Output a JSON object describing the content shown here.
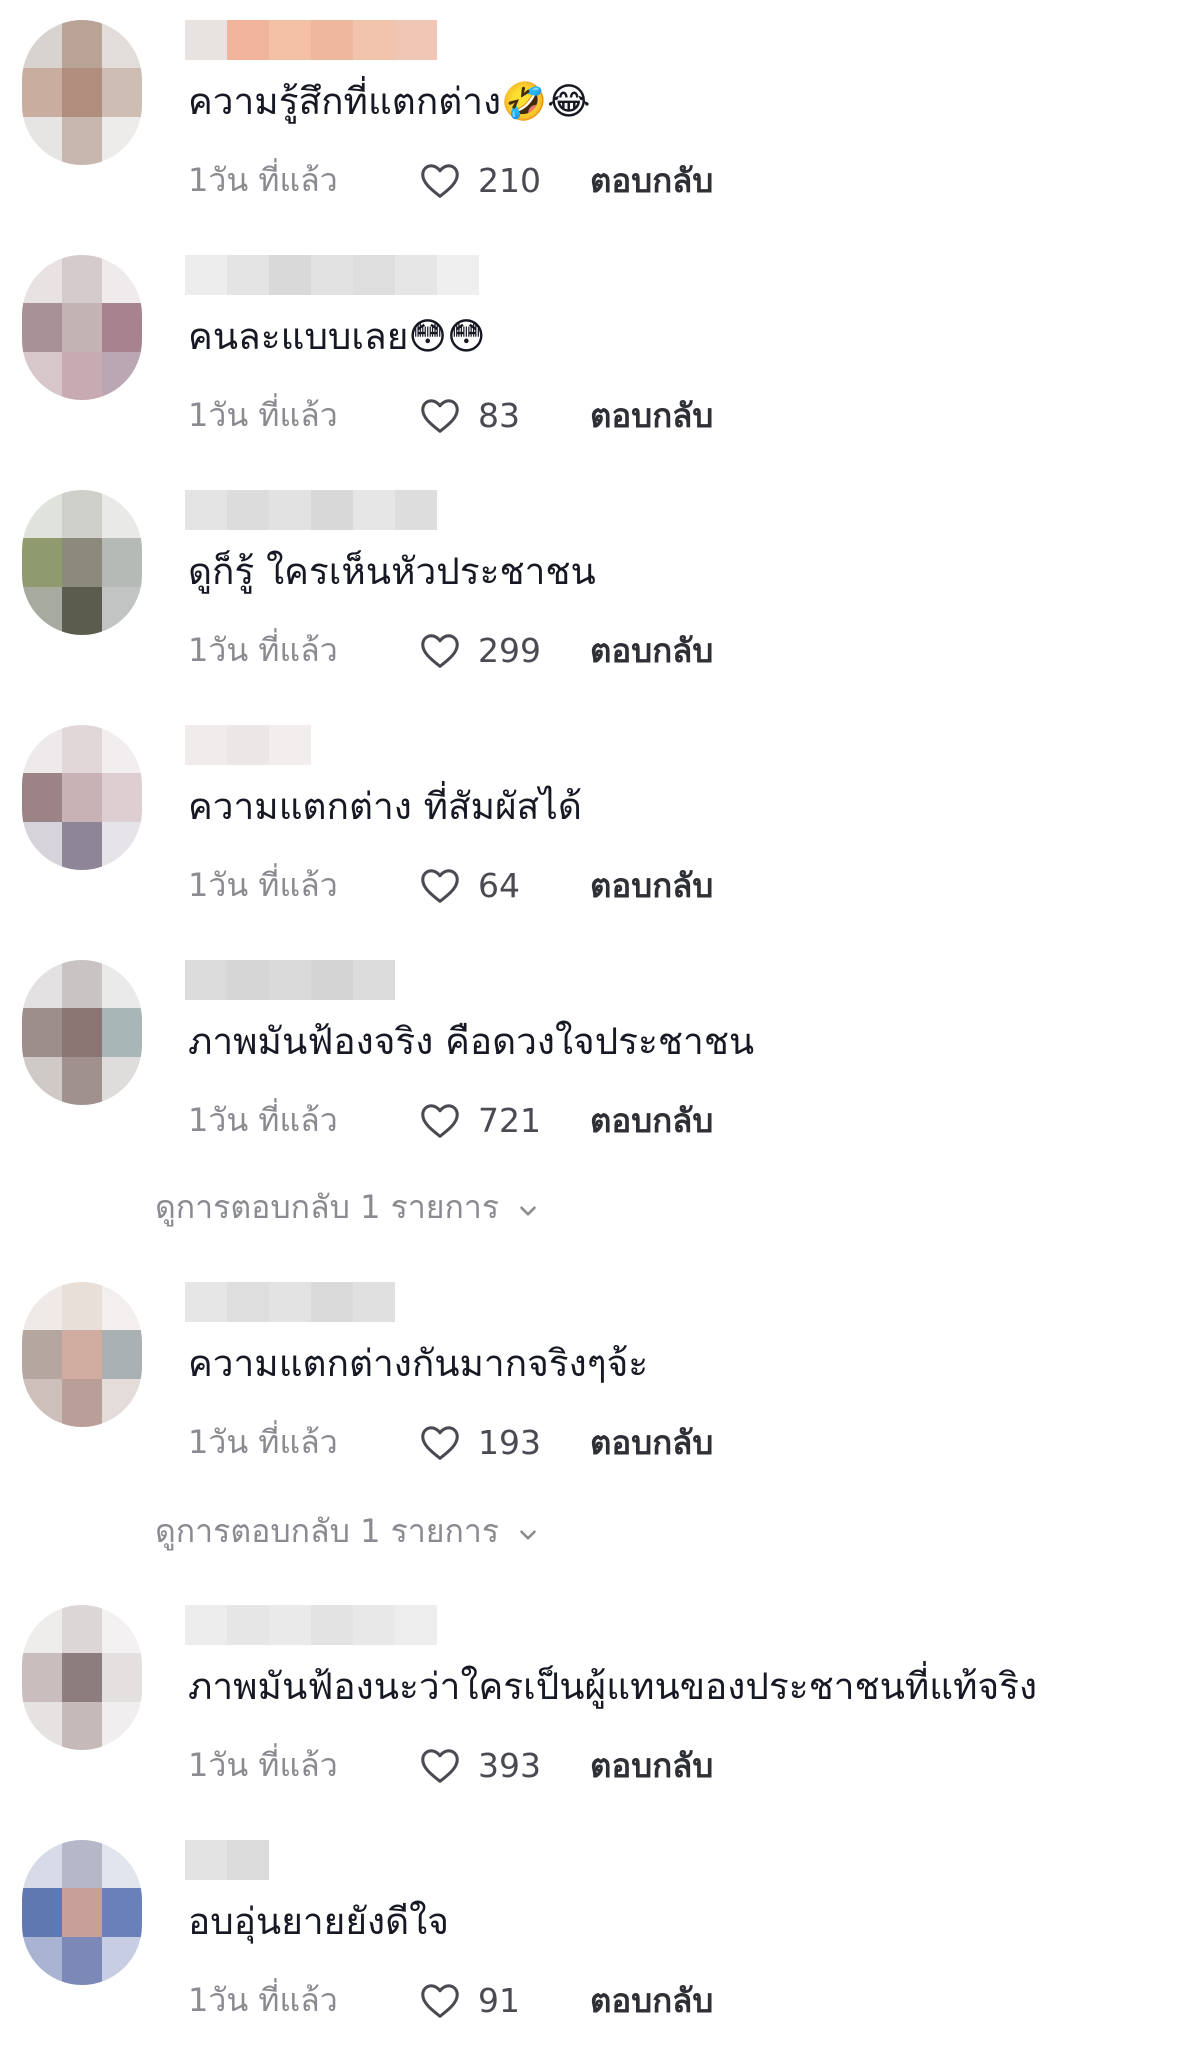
{
  "comments": [
    {
      "text": "ความรู้สึกที่แตกต่าง🤣😂",
      "time": "1วัน ที่แล้ว",
      "likes": "210",
      "reply_label": "ตอบกลับ"
    },
    {
      "text": "คนละแบบเลย😳😳",
      "time": "1วัน ที่แล้ว",
      "likes": "83",
      "reply_label": "ตอบกลับ"
    },
    {
      "text": "ดูก็รู้ ใครเห็นหัวประชาชน",
      "time": "1วัน ที่แล้ว",
      "likes": "299",
      "reply_label": "ตอบกลับ"
    },
    {
      "text": "ความแตกต่าง ที่สัมผัสได้",
      "time": "1วัน ที่แล้ว",
      "likes": "64",
      "reply_label": "ตอบกลับ"
    },
    {
      "text": "ภาพมันฟ้องจริง คือดวงใจประชาชน",
      "time": "1วัน ที่แล้ว",
      "likes": "721",
      "reply_label": "ตอบกลับ"
    },
    {
      "text": "ความแตกต่างกันมากจริงๆจ้ะ",
      "time": "1วัน ที่แล้ว",
      "likes": "193",
      "reply_label": "ตอบกลับ"
    },
    {
      "text": "ภาพมันฟ้องนะว่าใครเป็นผู้แทนของประชาชนที่แท้จริง",
      "time": "1วัน ที่แล้ว",
      "likes": "393",
      "reply_label": "ตอบกลับ"
    },
    {
      "text": "อบอุ่นยายยังดีใจ",
      "time": "1วัน ที่แล้ว",
      "likes": "91",
      "reply_label": "ตอบกลับ"
    }
  ],
  "view_replies": [
    {
      "label": "ดูการตอบกลับ 1 รายการ"
    },
    {
      "label": "ดูการตอบกลับ 1 รายการ"
    }
  ],
  "icons": {
    "like": "heart-outline-icon",
    "expand": "chevron-down-icon"
  },
  "colors": {
    "text_primary": "#161823",
    "text_secondary": "#8a8b91",
    "reply": "#2f3036"
  }
}
